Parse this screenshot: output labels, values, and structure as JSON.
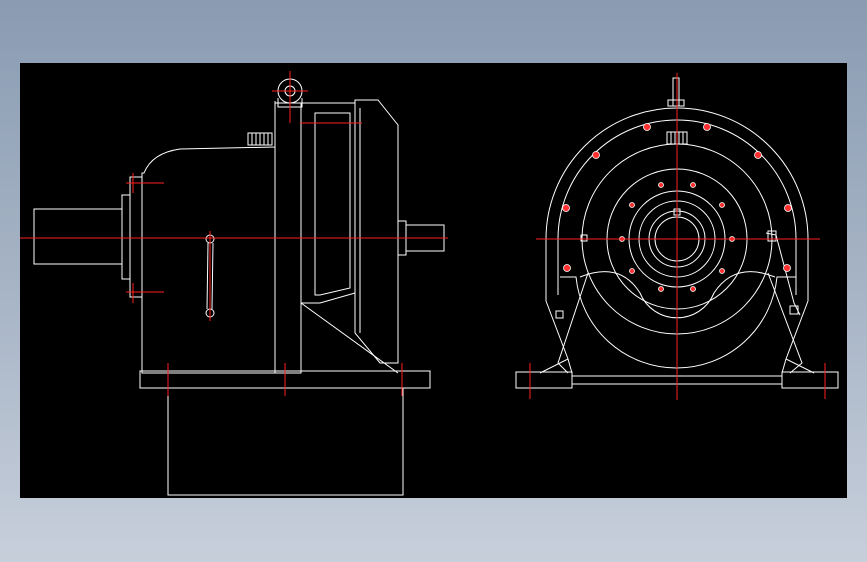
{
  "colors": {
    "background_top": "#8a9bb2",
    "background_bottom": "#c7cfdb",
    "canvas": "#000000",
    "outline": "#ffffff",
    "centerline": "#ff2020"
  },
  "drawing": {
    "views": [
      "side-view",
      "front-view"
    ]
  }
}
